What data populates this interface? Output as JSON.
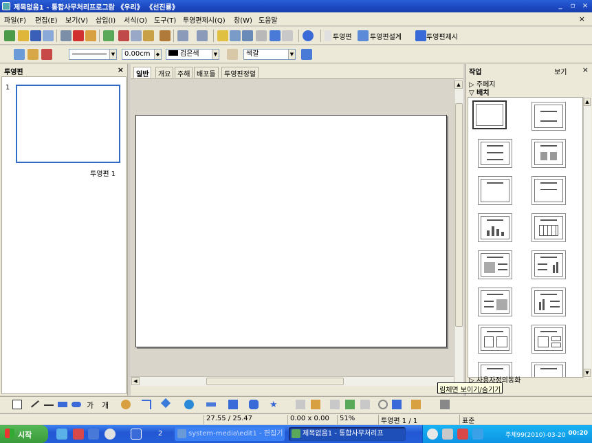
{
  "window": {
    "title": "제목없음1 - 통합사무처리프로그람 《우리》 《선진룡》",
    "controls": [
      "_",
      "▫",
      "×"
    ]
  },
  "menu": {
    "items": [
      "파일(F)",
      "편집(E)",
      "보기(V)",
      "삽입(I)",
      "서식(O)",
      "도구(T)",
      "투영편제시(Q)",
      "창(W)",
      "도움말"
    ],
    "close": "×"
  },
  "toolbar1": {
    "slide_label": "투영편",
    "slide_design_label": "투영편설계",
    "slide_show_label": "투영편제시"
  },
  "toolbar2": {
    "line_width": "0.00cm",
    "line_color": "검은색",
    "area_color": "색갈"
  },
  "slides_panel": {
    "title": "투영편",
    "close": "×",
    "slide_number": "1",
    "slide_label": "투영편 1"
  },
  "edit_area": {
    "tabs": [
      "일반",
      "개요",
      "주해",
      "배포들",
      "투영편정렬"
    ],
    "active_tab": "일반"
  },
  "task_pane": {
    "title": "작업",
    "view_label": "보기",
    "close": "×",
    "section_master": "▷ 주페지",
    "section_layout": "▽ 배치",
    "section_custom_animation": "▷ 사용자정의동화",
    "layouts": [
      "blank",
      "title-only-centered",
      "title-content",
      "title-2content",
      "title-only",
      "centered-text",
      "title-chart",
      "title-table",
      "title-clipart-text",
      "title-text-chart",
      "title-text-clipart",
      "title-chart-text",
      "title-text-2",
      "title-text-split"
    ]
  },
  "tooltip": {
    "text": "림체면 보이기/숨기기"
  },
  "statusbar": {
    "position": "27.55 / 25.47",
    "size": "0.00 x 0.00",
    "zoom": "51%",
    "slide": "투영편 1 / 1",
    "layout": "표준"
  },
  "taskbar": {
    "start_label": "시작",
    "group_count": "2",
    "tasks": [
      {
        "label": "system-media\\edit1 - 편집기",
        "active": false
      },
      {
        "label": "제목없음1 - 통합사무처리프",
        "active": true
      }
    ],
    "date": "주체99(2010)-03-20",
    "clock": "00:20"
  },
  "colors": {
    "title_bar": "#1c48c0",
    "selection_border": "#3169c6",
    "taskbar": "#245ed8",
    "start_button": "#3a9b3a",
    "tooltip_bg": "#ffffe1"
  }
}
